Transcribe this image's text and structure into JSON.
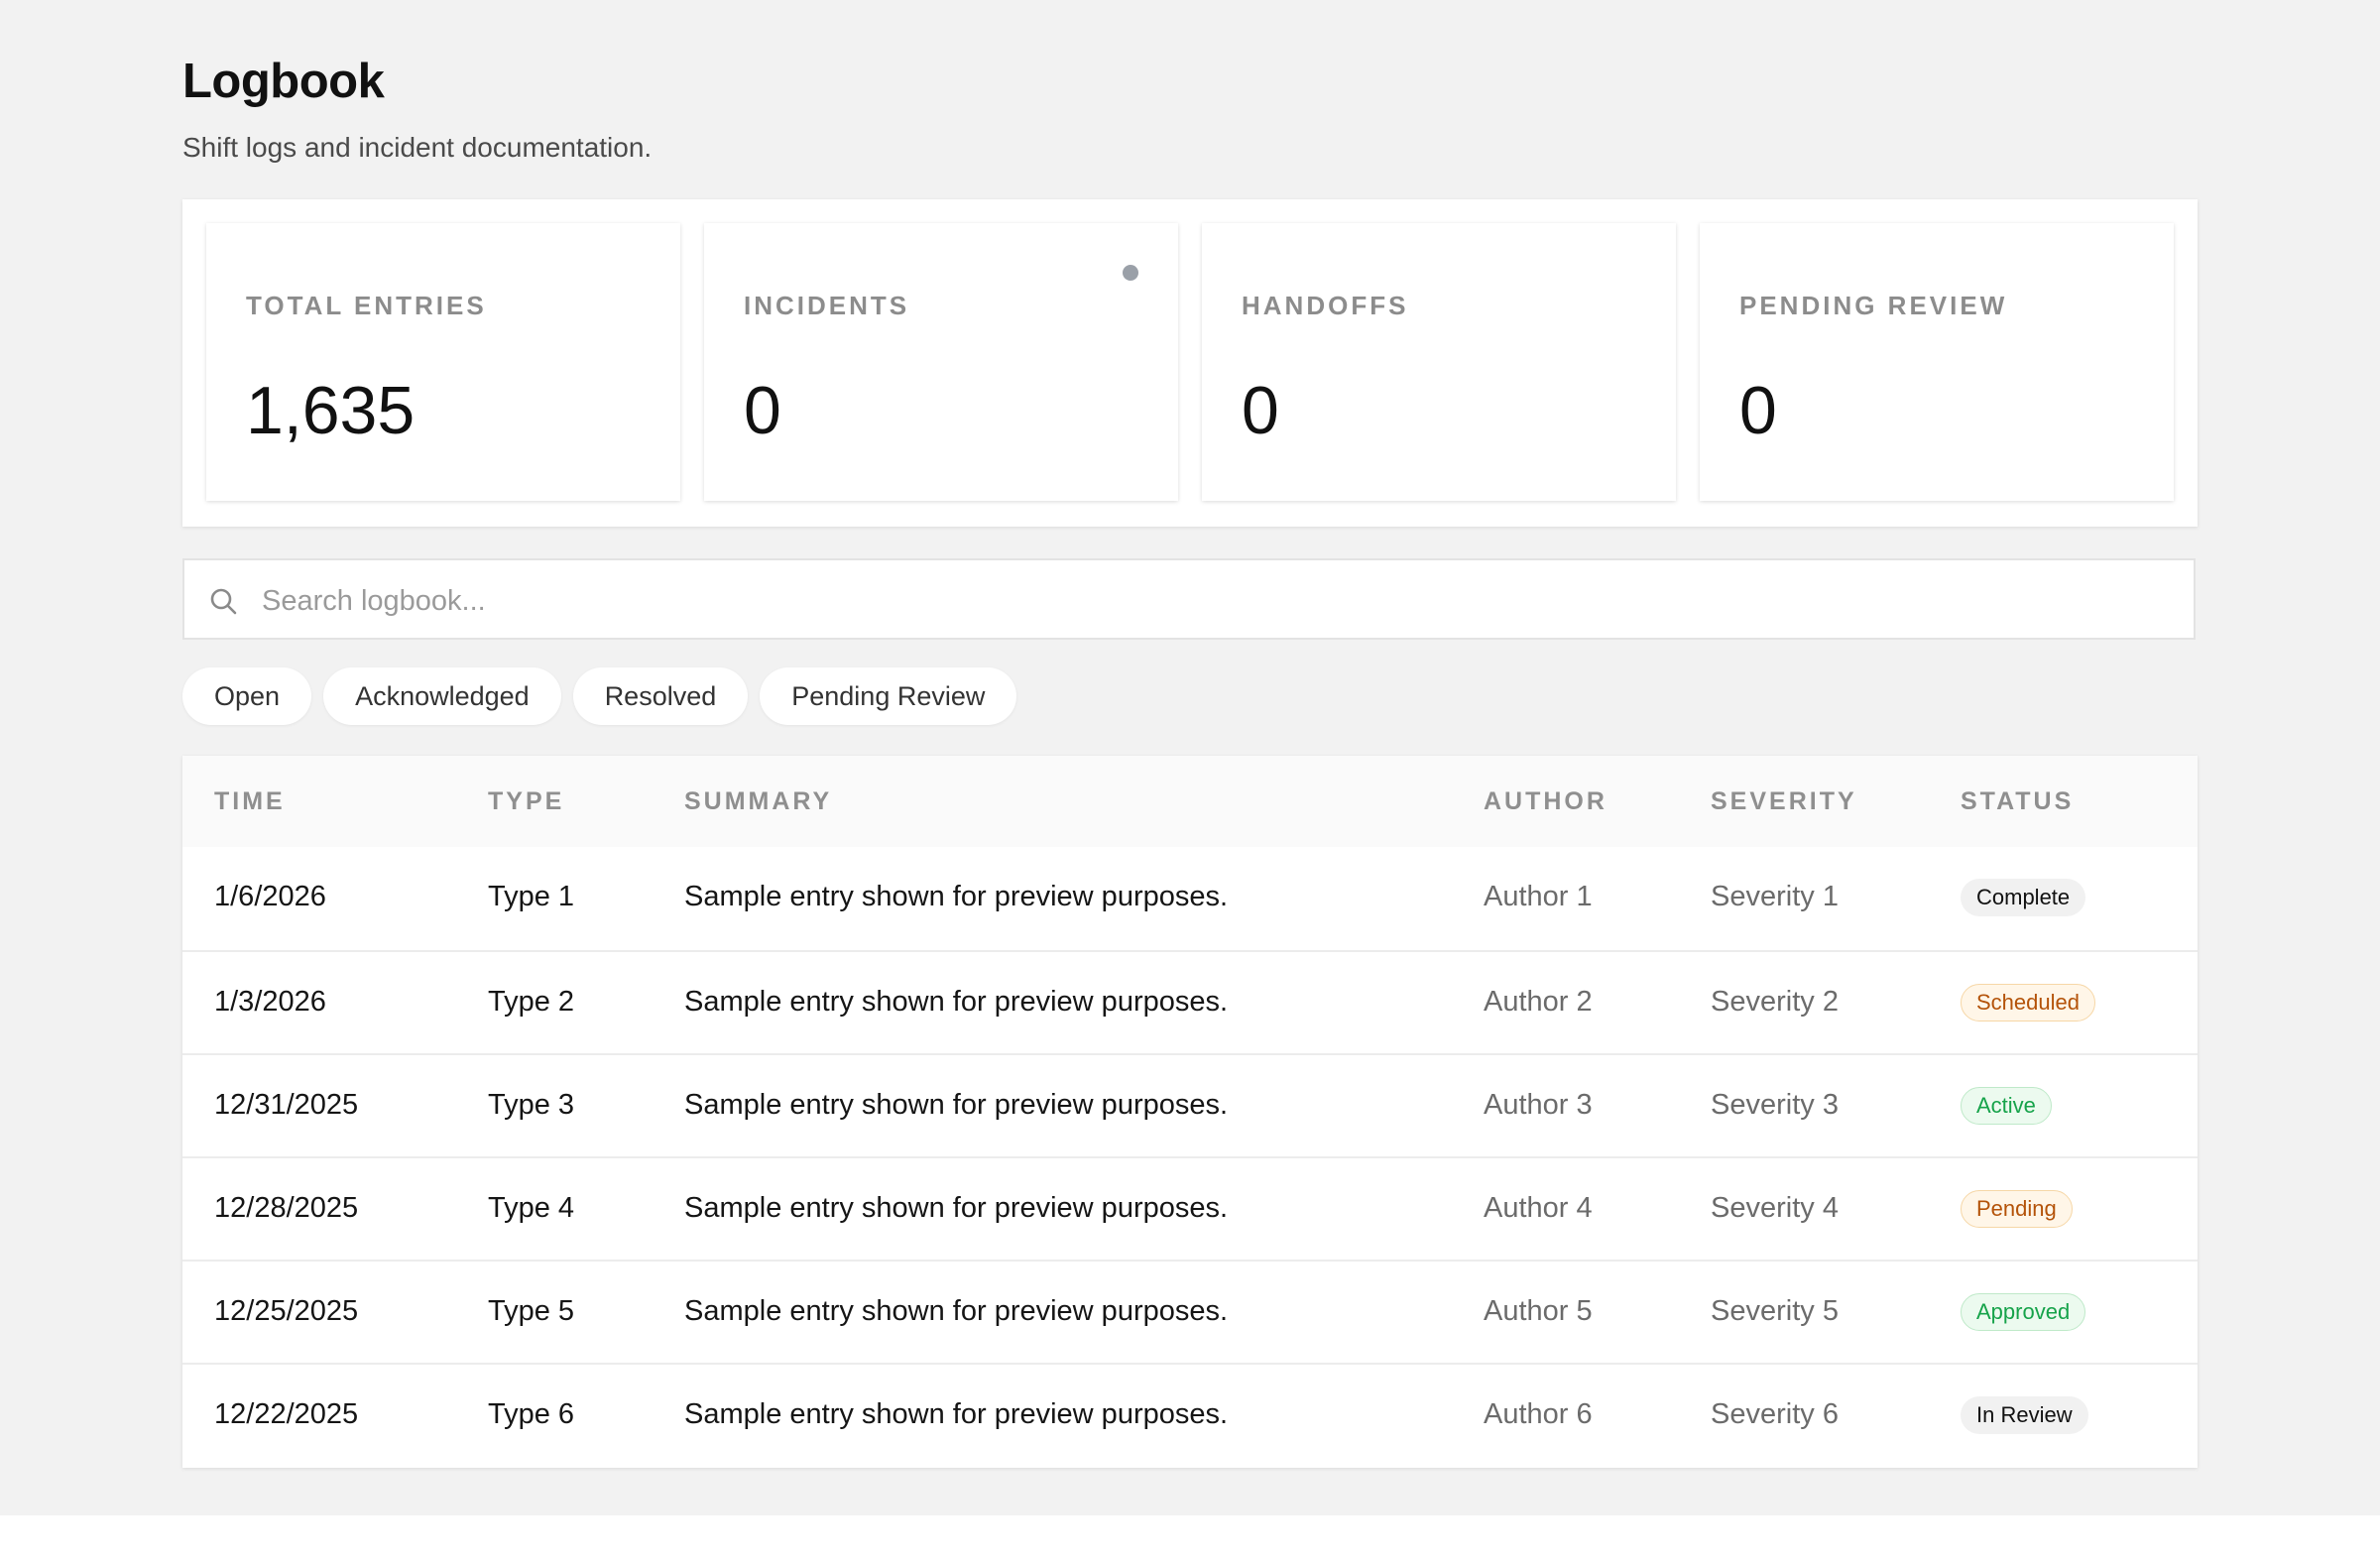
{
  "header": {
    "title": "Logbook",
    "subtitle": "Shift logs and incident documentation."
  },
  "stats": [
    {
      "label": "TOTAL ENTRIES",
      "value": "1,635"
    },
    {
      "label": "INCIDENTS",
      "value": "0",
      "indicator": "status-dot"
    },
    {
      "label": "HANDOFFS",
      "value": "0"
    },
    {
      "label": "PENDING REVIEW",
      "value": "0"
    }
  ],
  "search": {
    "placeholder": "Search logbook...",
    "value": "",
    "icon": "search-icon"
  },
  "filters": [
    "Open",
    "Acknowledged",
    "Resolved",
    "Pending Review"
  ],
  "table": {
    "columns": [
      "TIME",
      "TYPE",
      "SUMMARY",
      "AUTHOR",
      "SEVERITY",
      "STATUS"
    ],
    "rows": [
      {
        "time": "1/6/2026",
        "type": "Type 1",
        "summary": "Sample entry shown for preview purposes.",
        "author": "Author 1",
        "severity": "Severity 1",
        "status": "Complete"
      },
      {
        "time": "1/3/2026",
        "type": "Type 2",
        "summary": "Sample entry shown for preview purposes.",
        "author": "Author 2",
        "severity": "Severity 2",
        "status": "Scheduled"
      },
      {
        "time": "12/31/2025",
        "type": "Type 3",
        "summary": "Sample entry shown for preview purposes.",
        "author": "Author 3",
        "severity": "Severity 3",
        "status": "Active"
      },
      {
        "time": "12/28/2025",
        "type": "Type 4",
        "summary": "Sample entry shown for preview purposes.",
        "author": "Author 4",
        "severity": "Severity 4",
        "status": "Pending"
      },
      {
        "time": "12/25/2025",
        "type": "Type 5",
        "summary": "Sample entry shown for preview purposes.",
        "author": "Author 5",
        "severity": "Severity 5",
        "status": "Approved"
      },
      {
        "time": "12/22/2025",
        "type": "Type 6",
        "summary": "Sample entry shown for preview purposes.",
        "author": "Author 6",
        "severity": "Severity 6",
        "status": "In Review"
      }
    ]
  },
  "colors": {
    "page_bg": "#f2f2f2",
    "status_orange": "#b45309",
    "status_green": "#16a34a",
    "indicator_dot": "#9aa0a8"
  }
}
